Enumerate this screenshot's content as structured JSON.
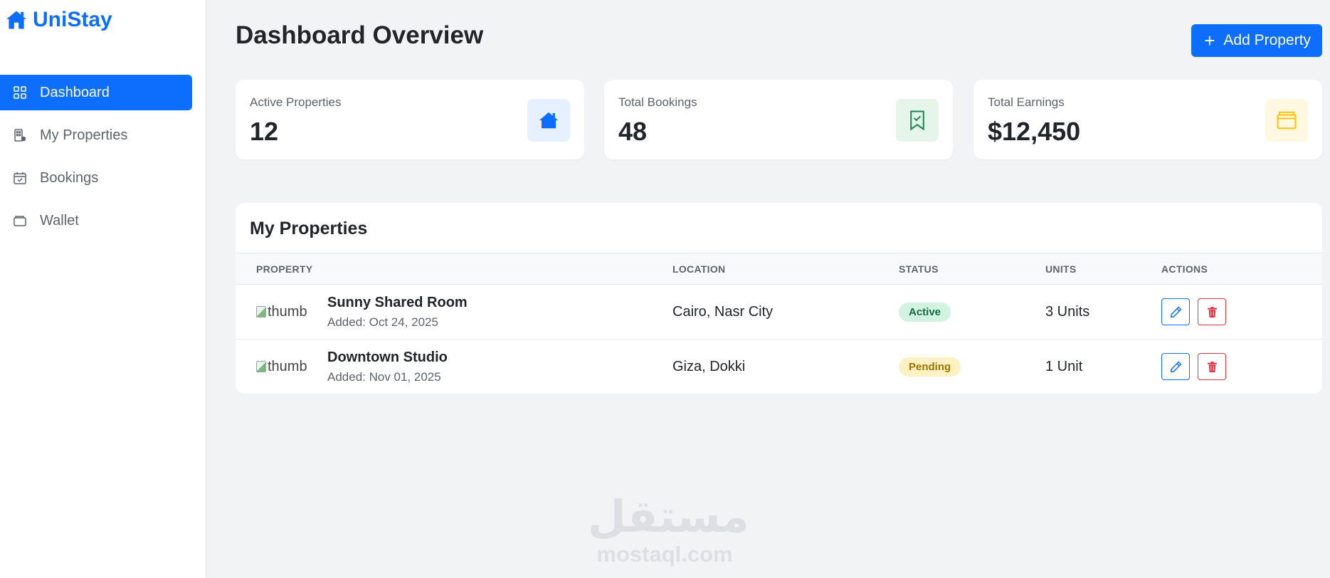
{
  "brand": {
    "name": "UniStay"
  },
  "sidebar": {
    "items": [
      {
        "label": "Dashboard",
        "icon": "grid-icon",
        "active": true
      },
      {
        "label": "My Properties",
        "icon": "building-icon",
        "active": false
      },
      {
        "label": "Bookings",
        "icon": "calendar-check-icon",
        "active": false
      },
      {
        "label": "Wallet",
        "icon": "wallet-icon",
        "active": false
      }
    ]
  },
  "header": {
    "title": "Dashboard Overview",
    "add_button": "Add Property"
  },
  "stats": [
    {
      "label": "Active Properties",
      "value": "12",
      "icon": "house-icon",
      "icon_bg": "#e7f0fe",
      "icon_color": "#0d6efd"
    },
    {
      "label": "Total Bookings",
      "value": "48",
      "icon": "bookmark-check-icon",
      "icon_bg": "#e6f4ea",
      "icon_color": "#198754"
    },
    {
      "label": "Total Earnings",
      "value": "$12,450",
      "icon": "wallet-icon",
      "icon_bg": "#fff8e1",
      "icon_color": "#ffc107"
    }
  ],
  "properties": {
    "title": "My Properties",
    "columns": [
      "PROPERTY",
      "LOCATION",
      "STATUS",
      "UNITS",
      "ACTIONS"
    ],
    "rows": [
      {
        "thumb_alt": "thumb",
        "name": "Sunny Shared Room",
        "added": "Added: Oct 24, 2025",
        "location": "Cairo, Nasr City",
        "status": "Active",
        "units": "3 Units"
      },
      {
        "thumb_alt": "thumb",
        "name": "Downtown Studio",
        "added": "Added: Nov 01, 2025",
        "location": "Giza, Dokki",
        "status": "Pending",
        "units": "1 Unit"
      }
    ]
  },
  "watermark": {
    "arabic": "مستقل",
    "latin": "mostaql.com"
  },
  "colors": {
    "primary": "#0d6efd",
    "danger": "#dc3545",
    "background": "#f2f3f5"
  }
}
